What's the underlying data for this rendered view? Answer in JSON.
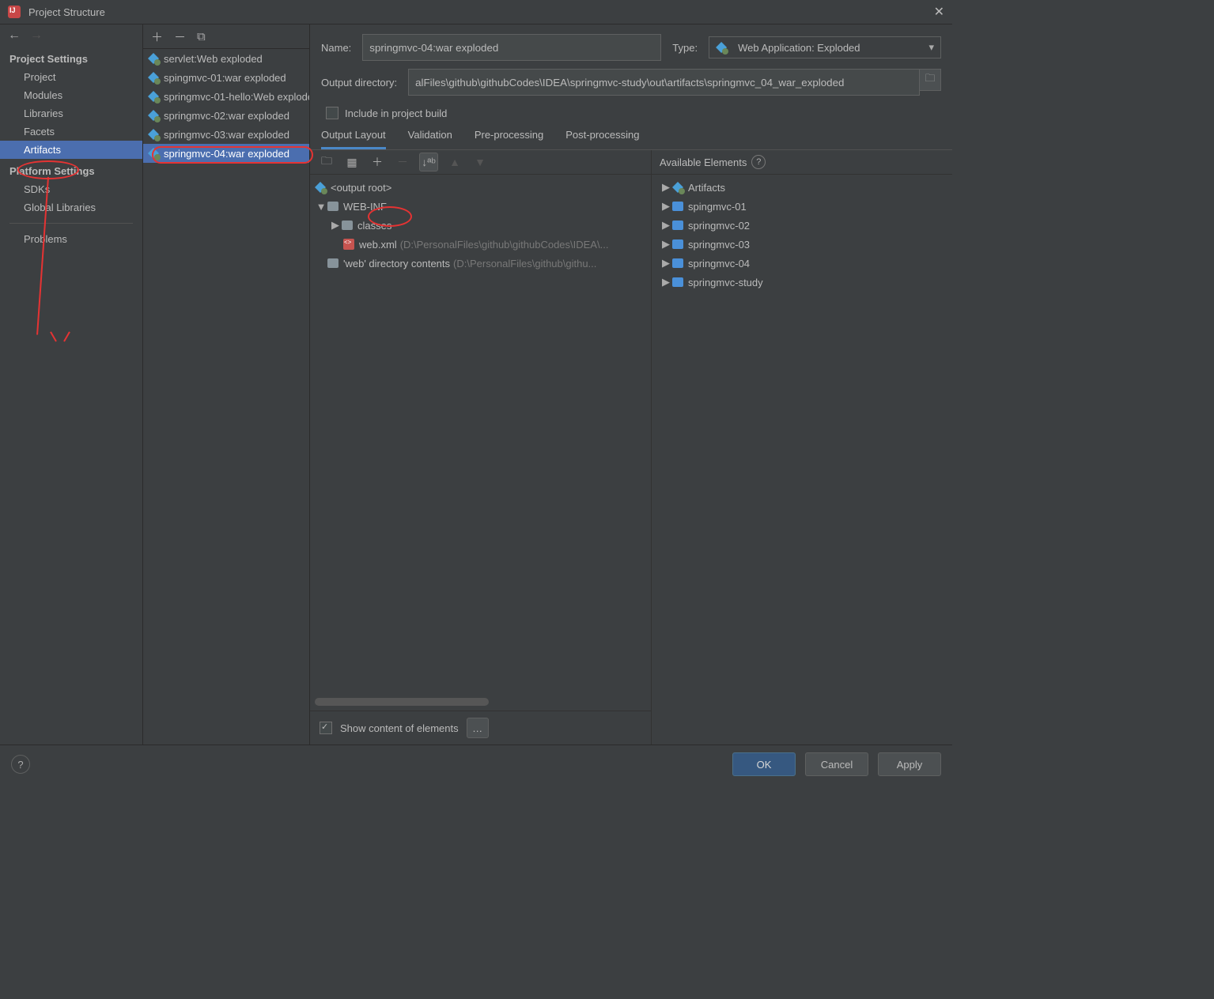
{
  "window": {
    "title": "Project Structure"
  },
  "sidebar": {
    "heading_project": "Project Settings",
    "items_project": [
      "Project",
      "Modules",
      "Libraries",
      "Facets",
      "Artifacts"
    ],
    "heading_platform": "Platform Settings",
    "items_platform": [
      "SDKs",
      "Global Libraries"
    ],
    "problems": "Problems"
  },
  "artifactList": [
    "servlet:Web exploded",
    "spingmvc-01:war exploded",
    "springmvc-01-hello:Web exploded",
    "springmvc-02:war exploded",
    "springmvc-03:war exploded",
    "springmvc-04:war exploded"
  ],
  "form": {
    "name_label": "Name:",
    "name_value": "springmvc-04:war exploded",
    "type_label": "Type:",
    "type_value": "Web Application: Exploded",
    "outdir_label": "Output directory:",
    "outdir_value": "alFiles\\github\\githubCodes\\IDEA\\springmvc-study\\out\\artifacts\\springmvc_04_war_exploded",
    "include_label": "Include in project build"
  },
  "tabs": [
    "Output Layout",
    "Validation",
    "Pre-processing",
    "Post-processing"
  ],
  "tree": {
    "root": "<output root>",
    "webinf": "WEB-INF",
    "classes": "classes",
    "webxml": "web.xml",
    "webxml_path": "(D:\\PersonalFiles\\github\\githubCodes\\IDEA\\...",
    "webdir": "'web' directory contents",
    "webdir_path": "(D:\\PersonalFiles\\github\\githu..."
  },
  "available": {
    "heading": "Available Elements",
    "items": [
      "Artifacts",
      "spingmvc-01",
      "springmvc-02",
      "springmvc-03",
      "springmvc-04",
      "springmvc-study"
    ]
  },
  "bottom": {
    "show_content": "Show content of elements"
  },
  "footer": {
    "ok": "OK",
    "cancel": "Cancel",
    "apply": "Apply"
  }
}
